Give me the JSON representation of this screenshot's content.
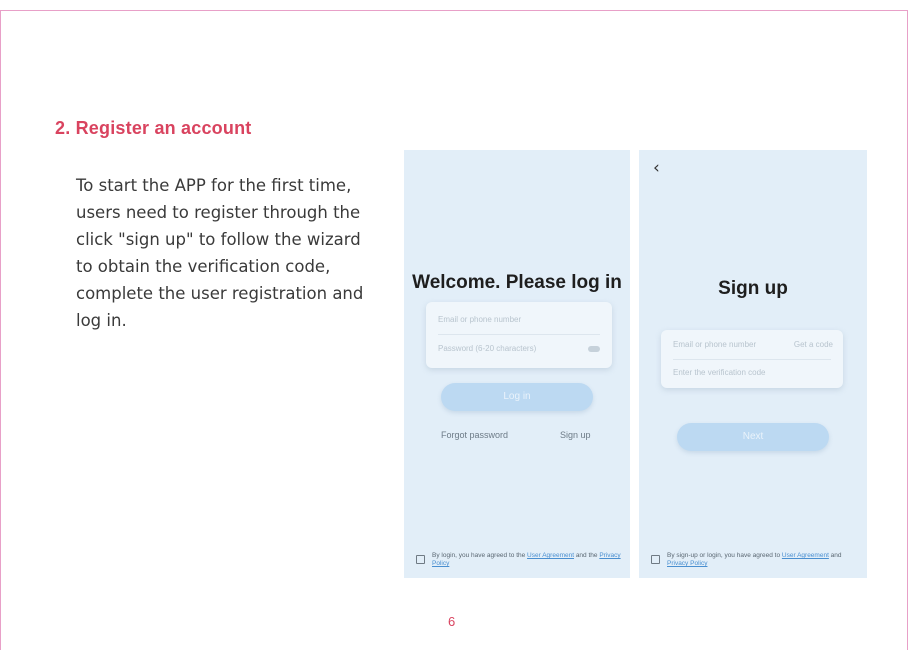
{
  "section": {
    "title": "2. Register an account",
    "body": "To start the APP for the first time, users need to register through the click \"sign up\" to follow the wizard to obtain the verification code, complete the user registration and log in."
  },
  "login_screen": {
    "heading": "Welcome. Please log in",
    "account_placeholder": "Email or phone number",
    "password_placeholder": "Password (6-20 characters)",
    "login_button": "Log in",
    "forgot_password": "Forgot password",
    "sign_up": "Sign up",
    "consent_prefix": "By login, you have agreed to the ",
    "user_agreement": "User Agreement",
    "consent_middle": " and the ",
    "privacy_policy": "Privacy Policy"
  },
  "signup_screen": {
    "back_icon": "back-arrow-icon",
    "heading": "Sign up",
    "account_placeholder": "Email or phone number",
    "get_code": "Get a code",
    "code_placeholder": "Enter the verification code",
    "next_button": "Next",
    "consent_prefix": "By sign-up or login, you have agreed to ",
    "user_agreement": "User Agreement",
    "consent_middle": " and ",
    "privacy_policy": "Privacy Policy"
  },
  "footer": {
    "page_number": "6"
  },
  "colors": {
    "accent": "#d9435f",
    "frame": "#e8a0c8",
    "screen_bg": "#e2eef8",
    "button": "#bcd9f2",
    "link": "#4a8fd0"
  }
}
